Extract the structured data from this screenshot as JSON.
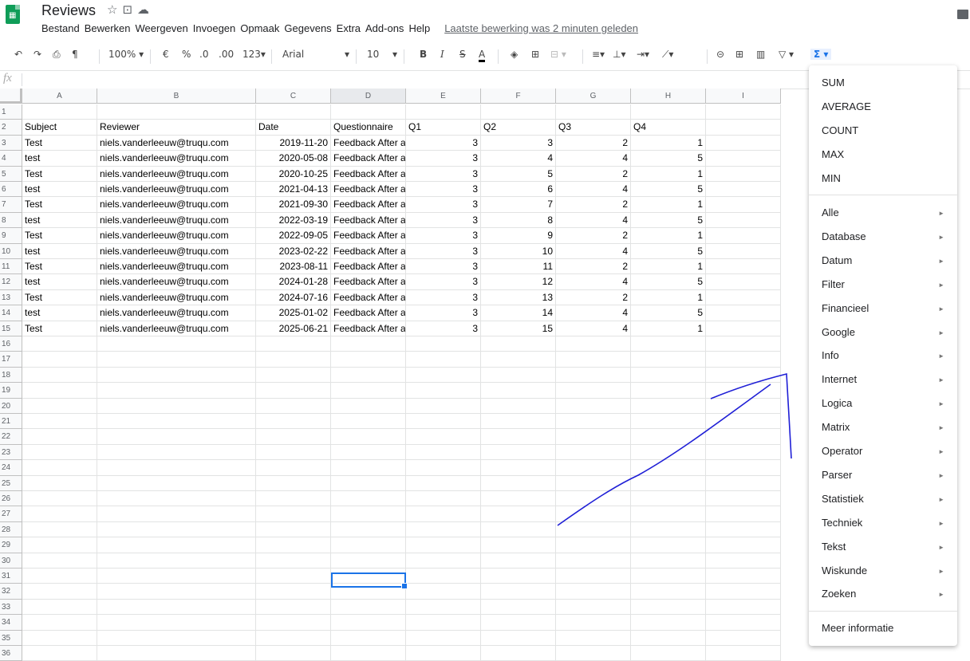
{
  "app": {
    "doc_title": "Reviews",
    "menu": [
      "Bestand",
      "Bewerken",
      "Weergeven",
      "Invoegen",
      "Opmaak",
      "Gegevens",
      "Extra",
      "Add-ons",
      "Help"
    ],
    "last_edit": "Laatste bewerking was 2 minuten geleden"
  },
  "toolbar": {
    "zoom": "100%",
    "currency": "€",
    "percent": "%",
    "decimal_less": ".0",
    "decimal_more": ".00",
    "format_more": "123",
    "font": "Arial",
    "font_size": "10",
    "bold": "B",
    "italic": "I",
    "strike": "S",
    "text_color": "A",
    "sigma": "Σ"
  },
  "formula_bar": {
    "fx": "fx"
  },
  "columns": [
    "A",
    "B",
    "C",
    "D",
    "E",
    "F",
    "G",
    "H",
    "I"
  ],
  "rows": [
    {
      "n": "1",
      "cells": [
        "",
        "",
        "",
        "",
        "",
        "",
        "",
        ""
      ]
    },
    {
      "n": "2",
      "cells": [
        "Subject",
        "Reviewer",
        "Date",
        "Questionnaire",
        "Q1",
        "Q2",
        "Q3",
        "Q4"
      ]
    },
    {
      "n": "3",
      "cells": [
        "Test",
        "niels.vanderleeuw@truqu.com",
        "2019-11-20",
        "Feedback After a",
        "3",
        "3",
        "2",
        "1"
      ]
    },
    {
      "n": "4",
      "cells": [
        "test",
        "niels.vanderleeuw@truqu.com",
        "2020-05-08",
        "Feedback After a",
        "3",
        "4",
        "4",
        "5"
      ]
    },
    {
      "n": "5",
      "cells": [
        "Test",
        "niels.vanderleeuw@truqu.com",
        "2020-10-25",
        "Feedback After a",
        "3",
        "5",
        "2",
        "1"
      ]
    },
    {
      "n": "6",
      "cells": [
        "test",
        "niels.vanderleeuw@truqu.com",
        "2021-04-13",
        "Feedback After a",
        "3",
        "6",
        "4",
        "5"
      ]
    },
    {
      "n": "7",
      "cells": [
        "Test",
        "niels.vanderleeuw@truqu.com",
        "2021-09-30",
        "Feedback After a",
        "3",
        "7",
        "2",
        "1"
      ]
    },
    {
      "n": "8",
      "cells": [
        "test",
        "niels.vanderleeuw@truqu.com",
        "2022-03-19",
        "Feedback After a",
        "3",
        "8",
        "4",
        "5"
      ]
    },
    {
      "n": "9",
      "cells": [
        "Test",
        "niels.vanderleeuw@truqu.com",
        "2022-09-05",
        "Feedback After a",
        "3",
        "9",
        "2",
        "1"
      ]
    },
    {
      "n": "10",
      "cells": [
        "test",
        "niels.vanderleeuw@truqu.com",
        "2023-02-22",
        "Feedback After a",
        "3",
        "10",
        "4",
        "5"
      ]
    },
    {
      "n": "11",
      "cells": [
        "Test",
        "niels.vanderleeuw@truqu.com",
        "2023-08-11",
        "Feedback After a",
        "3",
        "11",
        "2",
        "1"
      ]
    },
    {
      "n": "12",
      "cells": [
        "test",
        "niels.vanderleeuw@truqu.com",
        "2024-01-28",
        "Feedback After a",
        "3",
        "12",
        "4",
        "5"
      ]
    },
    {
      "n": "13",
      "cells": [
        "Test",
        "niels.vanderleeuw@truqu.com",
        "2024-07-16",
        "Feedback After a",
        "3",
        "13",
        "2",
        "1"
      ]
    },
    {
      "n": "14",
      "cells": [
        "test",
        "niels.vanderleeuw@truqu.com",
        "2025-01-02",
        "Feedback After a",
        "3",
        "14",
        "4",
        "5"
      ]
    },
    {
      "n": "15",
      "cells": [
        "Test",
        "niels.vanderleeuw@truqu.com",
        "2025-06-21",
        "Feedback After a",
        "3",
        "15",
        "4",
        "1"
      ]
    },
    {
      "n": "16",
      "cells": [
        "",
        "",
        "",
        "",
        "",
        "",
        "",
        ""
      ]
    },
    {
      "n": "17",
      "cells": [
        "",
        "",
        "",
        "",
        "",
        "",
        "",
        ""
      ]
    },
    {
      "n": "18",
      "cells": [
        "",
        "",
        "",
        "",
        "",
        "",
        "",
        ""
      ]
    },
    {
      "n": "19",
      "cells": [
        "",
        "",
        "",
        "",
        "",
        "",
        "",
        ""
      ]
    },
    {
      "n": "20",
      "cells": [
        "",
        "",
        "",
        "",
        "",
        "",
        "",
        ""
      ]
    },
    {
      "n": "21",
      "cells": [
        "",
        "",
        "",
        "",
        "",
        "",
        "",
        ""
      ]
    },
    {
      "n": "22",
      "cells": [
        "",
        "",
        "",
        "",
        "",
        "",
        "",
        ""
      ]
    },
    {
      "n": "23",
      "cells": [
        "",
        "",
        "",
        "",
        "",
        "",
        "",
        ""
      ]
    },
    {
      "n": "24",
      "cells": [
        "",
        "",
        "",
        "",
        "",
        "",
        "",
        ""
      ]
    },
    {
      "n": "25",
      "cells": [
        "",
        "",
        "",
        "",
        "",
        "",
        "",
        ""
      ]
    },
    {
      "n": "26",
      "cells": [
        "",
        "",
        "",
        "",
        "",
        "",
        "",
        ""
      ]
    },
    {
      "n": "27",
      "cells": [
        "",
        "",
        "",
        "",
        "",
        "",
        "",
        ""
      ]
    },
    {
      "n": "28",
      "cells": [
        "",
        "",
        "",
        "",
        "",
        "",
        "",
        ""
      ]
    },
    {
      "n": "29",
      "cells": [
        "",
        "",
        "",
        "",
        "",
        "",
        "",
        ""
      ]
    },
    {
      "n": "30",
      "cells": [
        "",
        "",
        "",
        "",
        "",
        "",
        "",
        ""
      ]
    },
    {
      "n": "31",
      "cells": [
        "",
        "",
        "",
        "",
        "",
        "",
        "",
        ""
      ]
    },
    {
      "n": "32",
      "cells": [
        "",
        "",
        "",
        "",
        "",
        "",
        "",
        ""
      ]
    },
    {
      "n": "33",
      "cells": [
        "",
        "",
        "",
        "",
        "",
        "",
        "",
        ""
      ]
    },
    {
      "n": "34",
      "cells": [
        "",
        "",
        "",
        "",
        "",
        "",
        "",
        ""
      ]
    },
    {
      "n": "35",
      "cells": [
        "",
        "",
        "",
        "",
        "",
        "",
        "",
        ""
      ]
    },
    {
      "n": "36",
      "cells": [
        "",
        "",
        "",
        "",
        "",
        "",
        "",
        ""
      ]
    }
  ],
  "functions_menu": {
    "quick": [
      "SUM",
      "AVERAGE",
      "COUNT",
      "MAX",
      "MIN"
    ],
    "categories": [
      "Alle",
      "Database",
      "Datum",
      "Filter",
      "Financieel",
      "Google",
      "Info",
      "Internet",
      "Logica",
      "Matrix",
      "Operator",
      "Parser",
      "Statistiek",
      "Techniek",
      "Tekst",
      "Wiskunde",
      "Zoeken"
    ],
    "more_info": "Meer informatie"
  },
  "colors": {
    "accent": "#1a73e8",
    "sheets_green": "#0f9d58",
    "annotation": "#1f1fd6"
  }
}
